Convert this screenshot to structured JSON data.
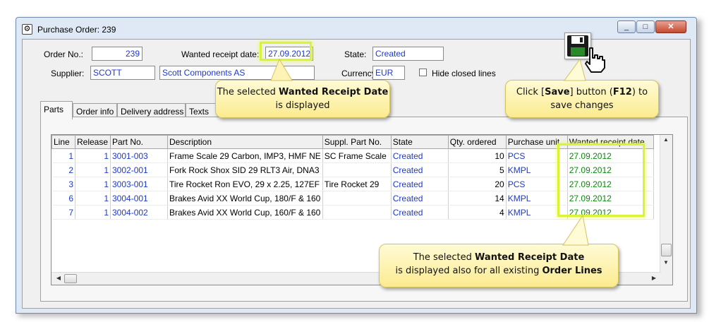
{
  "window": {
    "title": "Purchase Order: 239",
    "min_label": "_",
    "max_label": "□",
    "close_label": "✕"
  },
  "header": {
    "order_no_label": "Order No.:",
    "order_no": "239",
    "wanted_date_label": "Wanted receipt date:",
    "wanted_date": "27.09.2012",
    "state_label": "State:",
    "state": "Created",
    "supplier_label": "Supplier:",
    "supplier_code": "SCOTT",
    "supplier_name": "Scott Components AS",
    "currency_label": "Currency:",
    "currency": "EUR",
    "hide_closed_label": "Hide closed lines"
  },
  "tabs": [
    {
      "label": "Parts"
    },
    {
      "label": "Order info"
    },
    {
      "label": "Delivery address"
    },
    {
      "label": "Texts"
    }
  ],
  "grid": {
    "columns": [
      "Line",
      "Release",
      "Part No.",
      "Description",
      "Suppl. Part No.",
      "State",
      "Qty. ordered",
      "Purchase unit",
      "Wanted receipt date"
    ],
    "rows": [
      {
        "line": "1",
        "release": "1",
        "part_no": "3001-003",
        "description": "Frame Scale 29 Carbon, IMP3, HMF NE",
        "suppl_part_no": "SC Frame Scale",
        "state": "Created",
        "qty": "10",
        "unit": "PCS",
        "date": "27.09.2012"
      },
      {
        "line": "2",
        "release": "1",
        "part_no": "3002-001",
        "description": "Fork Rock Shox SID 29 RLT3 Air, DNA3",
        "suppl_part_no": "",
        "state": "Created",
        "qty": "5",
        "unit": "KMPL",
        "date": "27.09.2012"
      },
      {
        "line": "3",
        "release": "1",
        "part_no": "3003-001",
        "description": "Tire Rocket Ron EVO, 29 x 2.25, 127EF",
        "suppl_part_no": "Tire Rocket 29",
        "state": "Created",
        "qty": "20",
        "unit": "PCS",
        "date": "27.09.2012"
      },
      {
        "line": "6",
        "release": "1",
        "part_no": "3004-001",
        "description": "Brakes Avid XX World Cup, 180/F & 160",
        "suppl_part_no": "",
        "state": "Created",
        "qty": "14",
        "unit": "KMPL",
        "date": "27.09.2012"
      },
      {
        "line": "7",
        "release": "1",
        "part_no": "3004-002",
        "description": "Brakes Avid XX World Cup, 160/F & 160",
        "suppl_part_no": "",
        "state": "Created",
        "qty": "4",
        "unit": "KMPL",
        "date": "27.09.2012"
      }
    ]
  },
  "callouts": {
    "date_pre": "The selected ",
    "date_bold": "Wanted Receipt Date",
    "date_post": " is displayed",
    "save_pre": "Click [",
    "save_bold1": "Save",
    "save_mid": "] button (",
    "save_bold2": "F12",
    "save_post": ") to save changes",
    "lines_pre": "The selected ",
    "lines_bold1": "Wanted Receipt Date",
    "lines_mid": "is displayed also for all existing ",
    "lines_bold2": "Order Lines"
  },
  "colors": {
    "highlight": "#d9f23a",
    "callout_bg": "#fbeb8f",
    "field_text": "#1f39c8",
    "date_text": "#0b8a0b"
  },
  "icons": {
    "save": "floppy-disk-icon",
    "cursor": "hand-pointer-icon",
    "app": "gear-icon"
  }
}
